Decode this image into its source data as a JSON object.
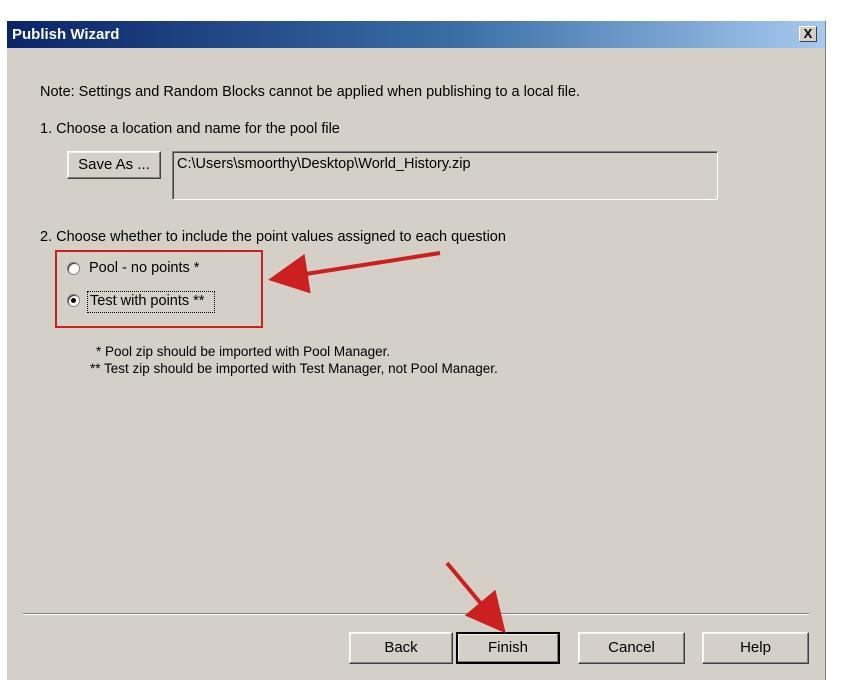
{
  "window": {
    "title": "Publish Wizard",
    "close_label": "X"
  },
  "content": {
    "note": "Note: Settings and Random Blocks cannot be applied when publishing to a local file.",
    "step1_label": "1.  Choose a location and name for the pool file",
    "save_as_label": "Save As ...",
    "file_path": "C:\\Users\\smoorthy\\Desktop\\World_History.zip",
    "step2_label": "2.  Choose whether to include the point values assigned to each question",
    "options": [
      {
        "label": "Pool - no points *",
        "selected": false
      },
      {
        "label": "Test with points **",
        "selected": true
      }
    ],
    "footnote1": "* Pool zip should be imported with Pool Manager.",
    "footnote2": "** Test zip should be imported with Test Manager, not Pool Manager."
  },
  "buttons": {
    "back": "Back",
    "finish": "Finish",
    "cancel": "Cancel",
    "help": "Help"
  },
  "annotations": {
    "highlight_color": "#cc1f1f",
    "arrow_color": "#cc1f1f"
  }
}
